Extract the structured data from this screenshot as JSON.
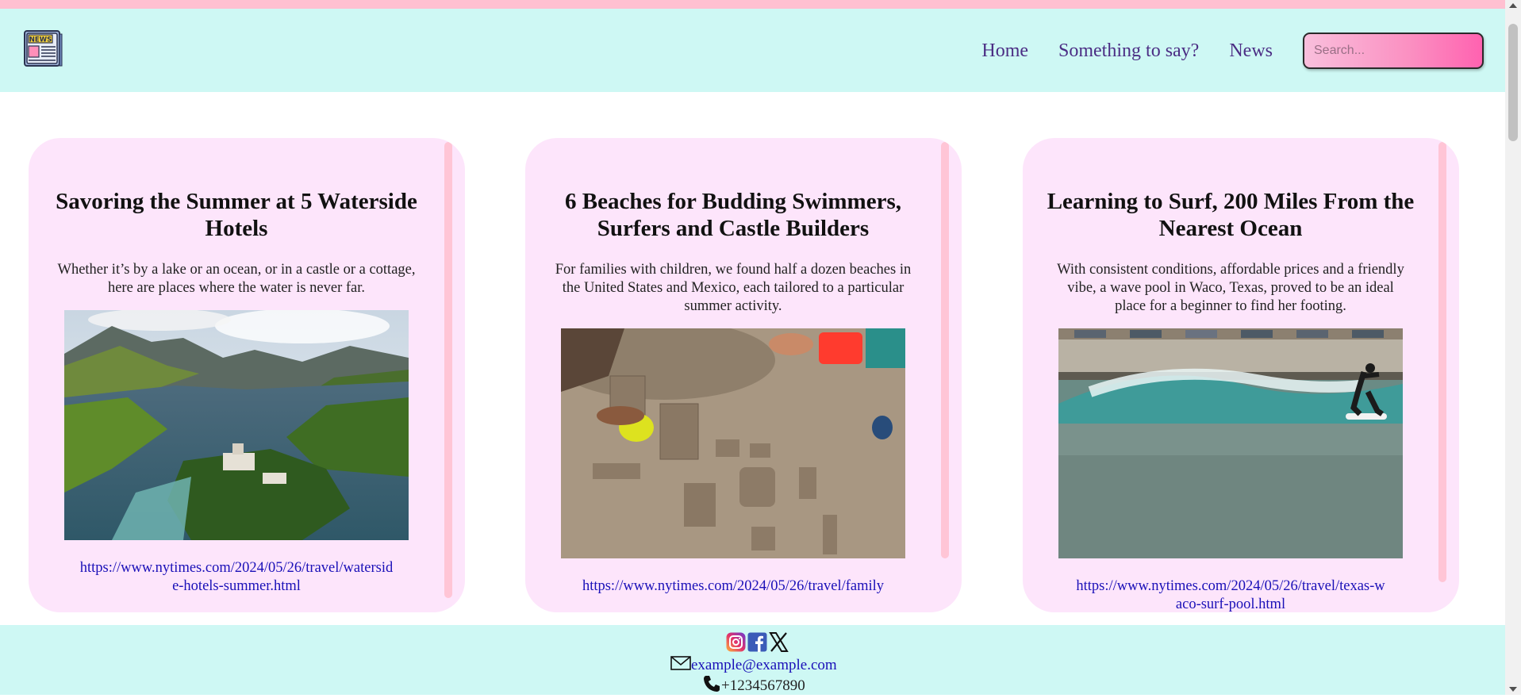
{
  "nav": {
    "items": [
      {
        "label": "Home"
      },
      {
        "label": "Something to say?"
      },
      {
        "label": "News"
      }
    ],
    "search_placeholder": "Search..."
  },
  "logo": {
    "text": "NEWS"
  },
  "articles": [
    {
      "title": "Savoring the Summer at 5 Waterside Hotels",
      "summary": "Whether it’s by a lake or an ocean, or in a castle or a cottage, here are places where the water is never far.",
      "url": "https://www.nytimes.com/2024/05/26/travel/waterside-hotels-summer.html",
      "image": "lake-landscape-image"
    },
    {
      "title": "6 Beaches for Budding Swimmers, Surfers and Castle Builders",
      "summary": "For families with children, we found half a dozen beaches in the United States and Mexico, each tailored to a particular summer activity.",
      "url": "https://www.nytimes.com/2024/05/26/travel/family",
      "image": "sandcastle-image"
    },
    {
      "title": "Learning to Surf, 200 Miles From the Nearest Ocean",
      "summary": "With consistent conditions, affordable prices and a friendly vibe, a wave pool in Waco, Texas, proved to be an ideal place for a beginner to find her footing.",
      "url": "https://www.nytimes.com/2024/05/26/travel/texas-waco-surf-pool.html",
      "image": "surf-pool-image"
    }
  ],
  "footer": {
    "email": "example@example.com",
    "phone": "+1234567890",
    "social": [
      "instagram-icon",
      "facebook-icon",
      "x-icon"
    ]
  },
  "colors": {
    "header_bg": "#cef8f4",
    "card_bg": "#fde5fb",
    "accent_pink": "#ffc0d1",
    "nav_text": "#4b2d84",
    "link": "#1a10b8"
  }
}
